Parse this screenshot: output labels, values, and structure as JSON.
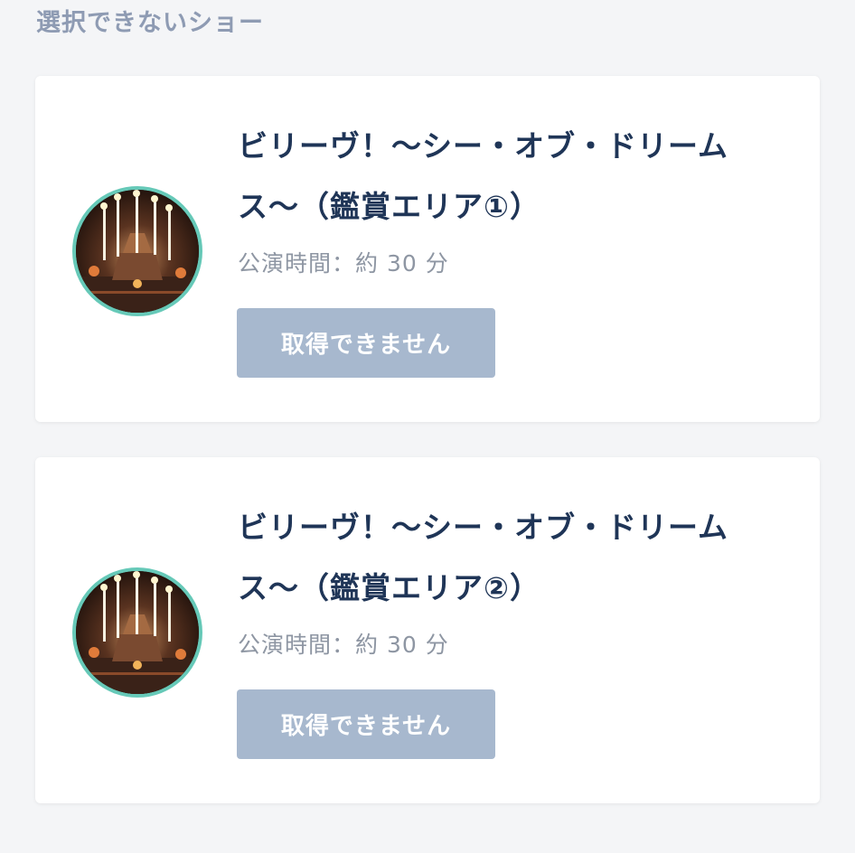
{
  "section": {
    "heading": "選択できないショー"
  },
  "shows": [
    {
      "title": "ビリーヴ！〜シー・オブ・ドリームス〜（鑑賞エリア①）",
      "duration": "公演時間：約 30 分",
      "button_label": "取得できません",
      "thumbnail": "fireworks-show-image"
    },
    {
      "title": "ビリーヴ！〜シー・オブ・ドリームス〜（鑑賞エリア②）",
      "duration": "公演時間：約 30 分",
      "button_label": "取得できません",
      "thumbnail": "fireworks-show-image"
    }
  ],
  "colors": {
    "heading": "#8e9bb3",
    "title": "#1f3557",
    "duration": "#8e96a3",
    "button_disabled_bg": "#a7b8ce",
    "thumbnail_ring": "#66c9b8",
    "card_bg": "#ffffff",
    "page_bg": "#f4f5f7"
  }
}
